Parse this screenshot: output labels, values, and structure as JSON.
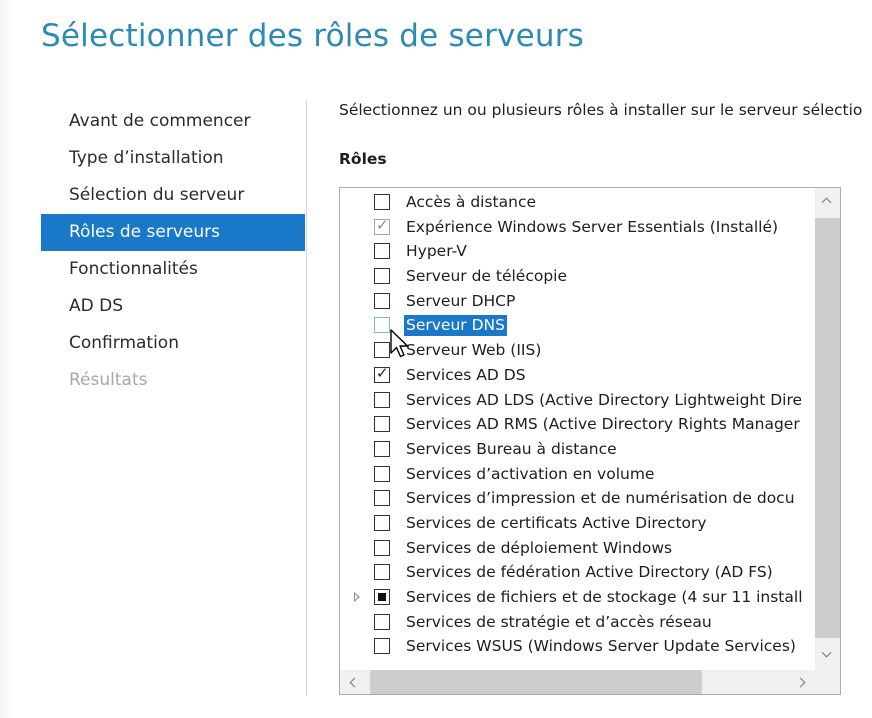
{
  "page": {
    "title": "Sélectionner des rôles de serveurs",
    "instruction": "Sélectionnez un ou plusieurs rôles à installer sur le serveur sélectio",
    "roles_heading": "Rôles"
  },
  "nav": {
    "items": [
      {
        "label": "Avant de commencer",
        "state": "normal"
      },
      {
        "label": "Type d’installation",
        "state": "normal"
      },
      {
        "label": "Sélection du serveur",
        "state": "normal"
      },
      {
        "label": "Rôles de serveurs",
        "state": "active"
      },
      {
        "label": "Fonctionnalités",
        "state": "normal"
      },
      {
        "label": "AD DS",
        "state": "normal"
      },
      {
        "label": "Confirmation",
        "state": "normal"
      },
      {
        "label": "Résultats",
        "state": "disabled"
      }
    ]
  },
  "roles": [
    {
      "label": "Accès à distance",
      "checked": false
    },
    {
      "label": "Expérience Windows Server Essentials (Installé)",
      "checked": true,
      "disabled": true
    },
    {
      "label": "Hyper-V",
      "checked": false
    },
    {
      "label": "Serveur de télécopie",
      "checked": false
    },
    {
      "label": "Serveur DHCP",
      "checked": false
    },
    {
      "label": "Serveur DNS",
      "checked": false,
      "selected": true,
      "hover": true
    },
    {
      "label": "Serveur Web (IIS)",
      "checked": false
    },
    {
      "label": "Services AD DS",
      "checked": true
    },
    {
      "label": "Services AD LDS (Active Directory Lightweight Dire",
      "checked": false
    },
    {
      "label": "Services AD RMS (Active Directory Rights Manager",
      "checked": false
    },
    {
      "label": "Services Bureau à distance",
      "checked": false
    },
    {
      "label": "Services d’activation en volume",
      "checked": false
    },
    {
      "label": "Services d’impression et de numérisation de docu",
      "checked": false
    },
    {
      "label": "Services de certificats Active Directory",
      "checked": false
    },
    {
      "label": "Services de déploiement Windows",
      "checked": false
    },
    {
      "label": "Services de fédération Active Directory (AD FS)",
      "checked": false
    },
    {
      "label": "Services de fichiers et de stockage (4 sur 11 install",
      "checked": "partial",
      "expandable": true
    },
    {
      "label": "Services de stratégie et d’accès réseau",
      "checked": false
    },
    {
      "label": "Services WSUS (Windows Server Update Services)",
      "checked": false
    }
  ],
  "colors": {
    "title": "#2b8bb0",
    "selection": "#1a78c8"
  },
  "icons": {
    "check": "✓",
    "expander": "triangle-right",
    "cursor": "arrow-cursor"
  }
}
